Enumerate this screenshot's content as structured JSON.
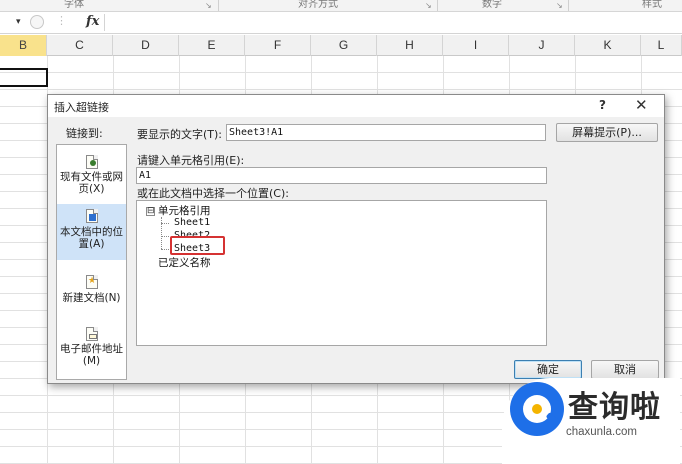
{
  "ribbon": {
    "groups": [
      "字体",
      "对齐方式",
      "数字",
      "样式"
    ]
  },
  "formula_bar": {
    "fx_label": "fx",
    "name_box_arrow": "▾"
  },
  "sheet": {
    "columns": [
      "B",
      "C",
      "D",
      "E",
      "F",
      "G",
      "H",
      "I",
      "J",
      "K",
      "L"
    ],
    "selected_column": "B"
  },
  "dialog": {
    "title": "插入超链接",
    "help_label": "?",
    "close_label": "✕",
    "link_to_label": "链接到:",
    "link_items": [
      {
        "label": "现有文件或网页(X)",
        "selected": false
      },
      {
        "label": "本文档中的位置(A)",
        "selected": true
      },
      {
        "label": "新建文档(N)",
        "selected": false
      },
      {
        "label": "电子邮件地址(M)",
        "selected": false
      }
    ],
    "display_text_label": "要显示的文字(T):",
    "display_text_value": "Sheet3!A1",
    "screentip_button": "屏幕提示(P)...",
    "cell_ref_label": "请键入单元格引用(E):",
    "cell_ref_value": "A1",
    "place_label": "或在此文档中选择一个位置(C):",
    "tree": {
      "expander": "⊟",
      "root": "单元格引用",
      "sheets": [
        "Sheet1",
        "Sheet2",
        "Sheet3"
      ],
      "highlighted_sheet": "Sheet3",
      "defined_names": "已定义名称"
    },
    "ok_button": "确定",
    "cancel_button": "取消"
  },
  "watermark": {
    "title": "查询啦",
    "url": "chaxunla.com"
  },
  "colors": {
    "selected_column_header": "#f9e28c",
    "selected_link_item": "#cfe3f8",
    "highlight_border": "#d53232",
    "watermark_blue": "#1e6fe8"
  }
}
